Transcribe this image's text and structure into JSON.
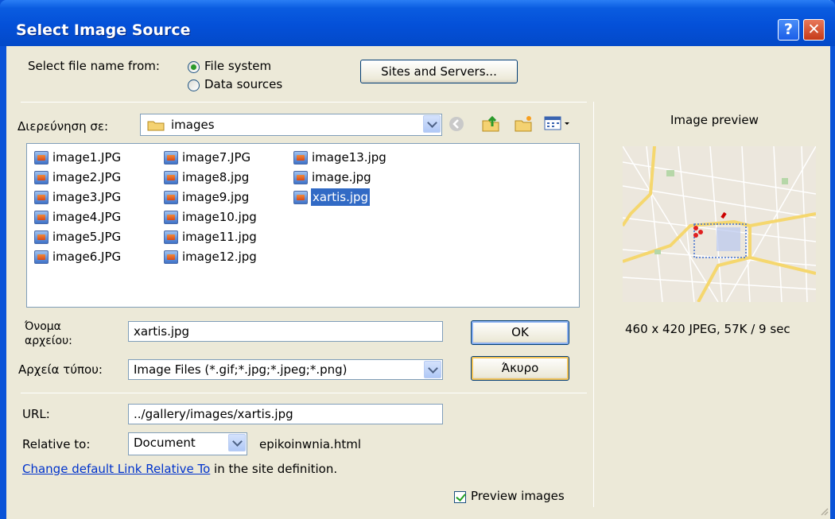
{
  "window": {
    "title": "Select Image Source",
    "help_glyph": "?",
    "close_glyph": "✕"
  },
  "source": {
    "label": "Select file name from:",
    "options": [
      {
        "label": "File system",
        "selected": true
      },
      {
        "label": "Data sources",
        "selected": false
      }
    ],
    "sites_button": "Sites and Servers..."
  },
  "browser": {
    "lookin_label": "Διερεύνηση σε:",
    "lookin_value": "images",
    "files": [
      [
        "image1.JPG",
        "image2.JPG",
        "image3.JPG",
        "image4.JPG",
        "image5.JPG",
        "image6.JPG"
      ],
      [
        "image7.JPG",
        "image8.jpg",
        "image9.jpg",
        "image10.jpg",
        "image11.jpg",
        "image12.jpg"
      ],
      [
        "image13.jpg",
        "image.jpg",
        "xartis.jpg"
      ]
    ],
    "selected_file": "xartis.jpg"
  },
  "filename": {
    "label_line1": "Όνομα",
    "label_line2": "αρχείου:",
    "value": "xartis.jpg"
  },
  "filetype": {
    "label": "Αρχεία τύπου:",
    "value": "Image Files (*.gif;*.jpg;*.jpeg;*.png)"
  },
  "buttons": {
    "ok": "OK",
    "cancel": "Άκυρο"
  },
  "url": {
    "label": "URL:",
    "value": "../gallery/images/xartis.jpg"
  },
  "relative": {
    "label": "Relative to:",
    "value": "Document",
    "page": "epikoinwnia.html"
  },
  "change_link": {
    "link_text": "Change default Link Relative To",
    "suffix": " in the site definition."
  },
  "preview_checkbox": {
    "label": "Preview images",
    "checked": true
  },
  "preview": {
    "title": "Image preview",
    "info": "460 x 420 JPEG, 57K / 9 sec"
  }
}
